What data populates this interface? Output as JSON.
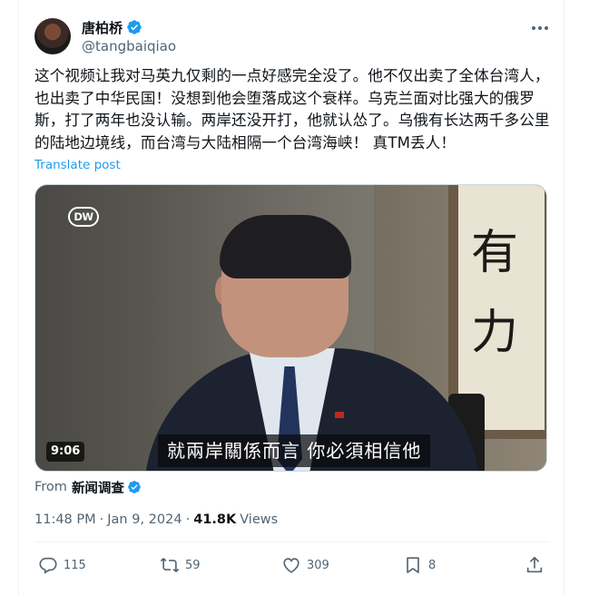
{
  "author": {
    "display_name": "唐柏桥",
    "handle": "@tangbaiqiao"
  },
  "tweet": {
    "text": "这个视频让我对马英九仅剩的一点好感完全没了。他不仅出卖了全体台湾人，也出卖了中华民国！没想到他会堕落成这个衰样。乌克兰面对比强大的俄罗斯，打了两年也没认输。两岸还没开打，他就认怂了。乌俄有长达两千多公里的陆地边境线，而台湾与大陆相隔一个台湾海峡！ 真TM丢人！",
    "translate_label": "Translate post"
  },
  "video": {
    "logo_text": "DW",
    "subtitle": "就兩岸關係而言 你必須相信他",
    "duration": "9:06",
    "calligraphy": [
      "有",
      "力"
    ]
  },
  "source": {
    "prefix": "From",
    "name": "新闻调查"
  },
  "meta": {
    "time": "11:48 PM",
    "separator": "·",
    "date": "Jan 9, 2024",
    "views_count": "41.8K",
    "views_label": "Views"
  },
  "actions": {
    "replies": "115",
    "reposts": "59",
    "likes": "309",
    "bookmarks": "8"
  },
  "icons": {
    "verified": "verified-badge-icon",
    "more": "more-dots-icon",
    "reply": "reply-icon",
    "repost": "repost-icon",
    "like": "heart-icon",
    "bookmark": "bookmark-icon",
    "share": "share-icon"
  },
  "colors": {
    "accent": "#1d9bf0",
    "text_primary": "#0f1419",
    "text_secondary": "#536471"
  }
}
